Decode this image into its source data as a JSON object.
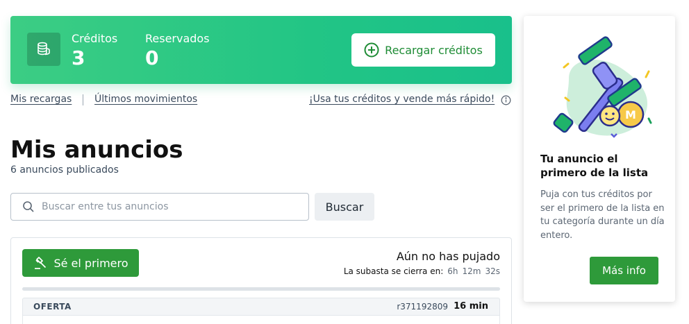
{
  "credits_banner": {
    "credits_label": "Créditos",
    "credits_value": "3",
    "reserved_label": "Reservados",
    "reserved_value": "0",
    "recharge_label": "Recargar créditos"
  },
  "links": {
    "recargas": "Mis recargas",
    "movimientos": "Últimos movimientos",
    "usa_creditos": "¡Usa tus créditos y vende más rápido!"
  },
  "main": {
    "title": "Mis anuncios",
    "subtitle": "6 anuncios publicados"
  },
  "search": {
    "placeholder": "Buscar entre tus anuncios",
    "button_label": "Buscar"
  },
  "ad": {
    "first_button_label": "Sé el primero",
    "bid_status": "Aún no has pujado",
    "auction_label": "La subasta se cierra en:",
    "auction_hours": "6h",
    "auction_minutes": "12m",
    "auction_seconds": "32s",
    "offer_label": "OFERTA",
    "reference": "r371192809",
    "time_ago": "16 min"
  },
  "promo": {
    "title": "Tu anuncio el primero de la lista",
    "description": "Puja con tus créditos por ser el primero de la lista en tu categoría durante un día entero.",
    "button_label": "Más info"
  },
  "colors": {
    "banner_green": "#22c585",
    "button_green": "#2e9a3a",
    "link_text": "#3a4a5c"
  },
  "icons": [
    "coins-icon",
    "plus-circle-icon",
    "info-icon",
    "search-icon",
    "gavel-icon",
    "auction-illustration"
  ]
}
